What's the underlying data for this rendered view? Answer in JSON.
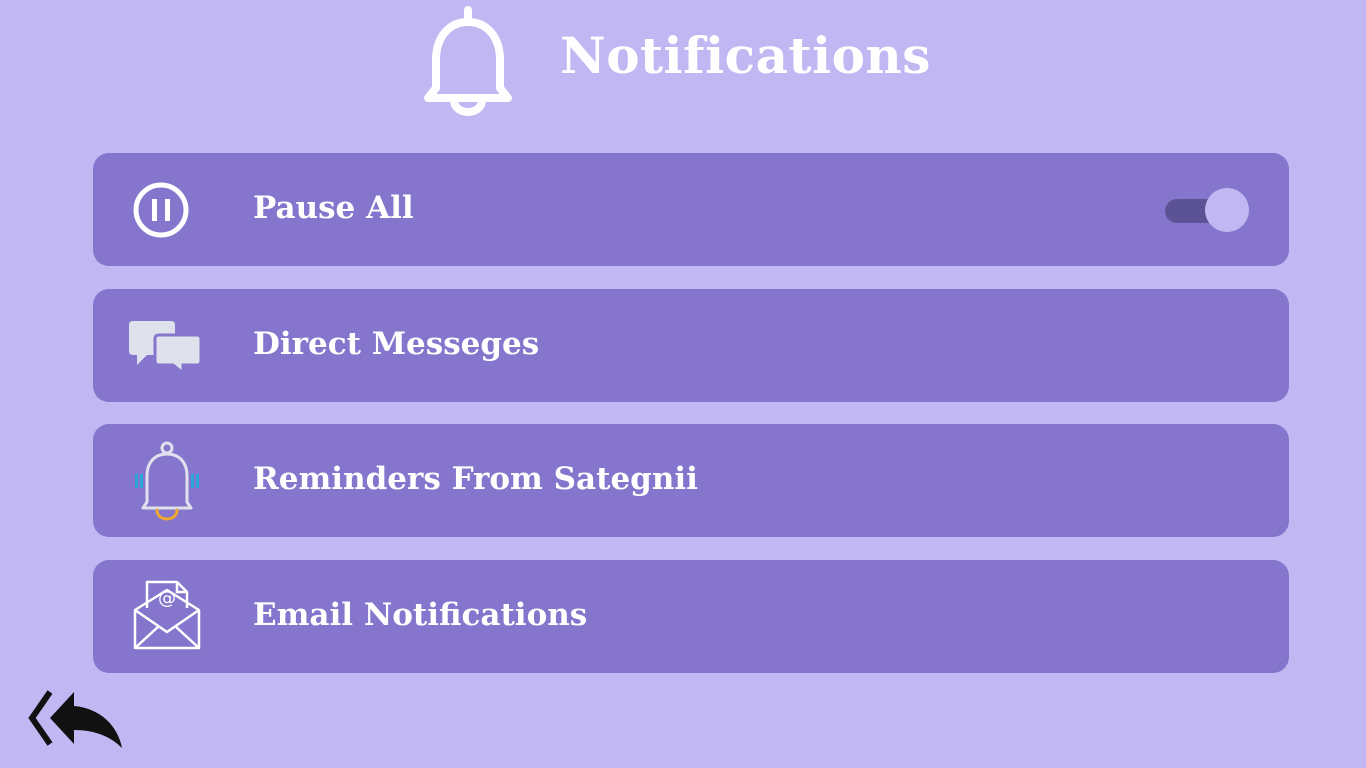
{
  "header": {
    "title": "Notifications",
    "icon": "bell-icon"
  },
  "settings": [
    {
      "label": "Pause All",
      "icon": "pause-icon",
      "has_toggle": true,
      "toggle_on": true
    },
    {
      "label": "Direct Messeges",
      "icon": "chat-bubbles-icon"
    },
    {
      "label": "Reminders From Sategnii",
      "icon": "ringing-bell-icon"
    },
    {
      "label": "Email Notifications",
      "icon": "email-icon"
    }
  ],
  "back": {
    "icon": "reply-all-icon"
  },
  "colors": {
    "background": "#c1b8f3",
    "card": "#8575cd",
    "text": "#ffffff",
    "toggle_track": "#5c5396",
    "toggle_knob": "#c1b8f3"
  }
}
